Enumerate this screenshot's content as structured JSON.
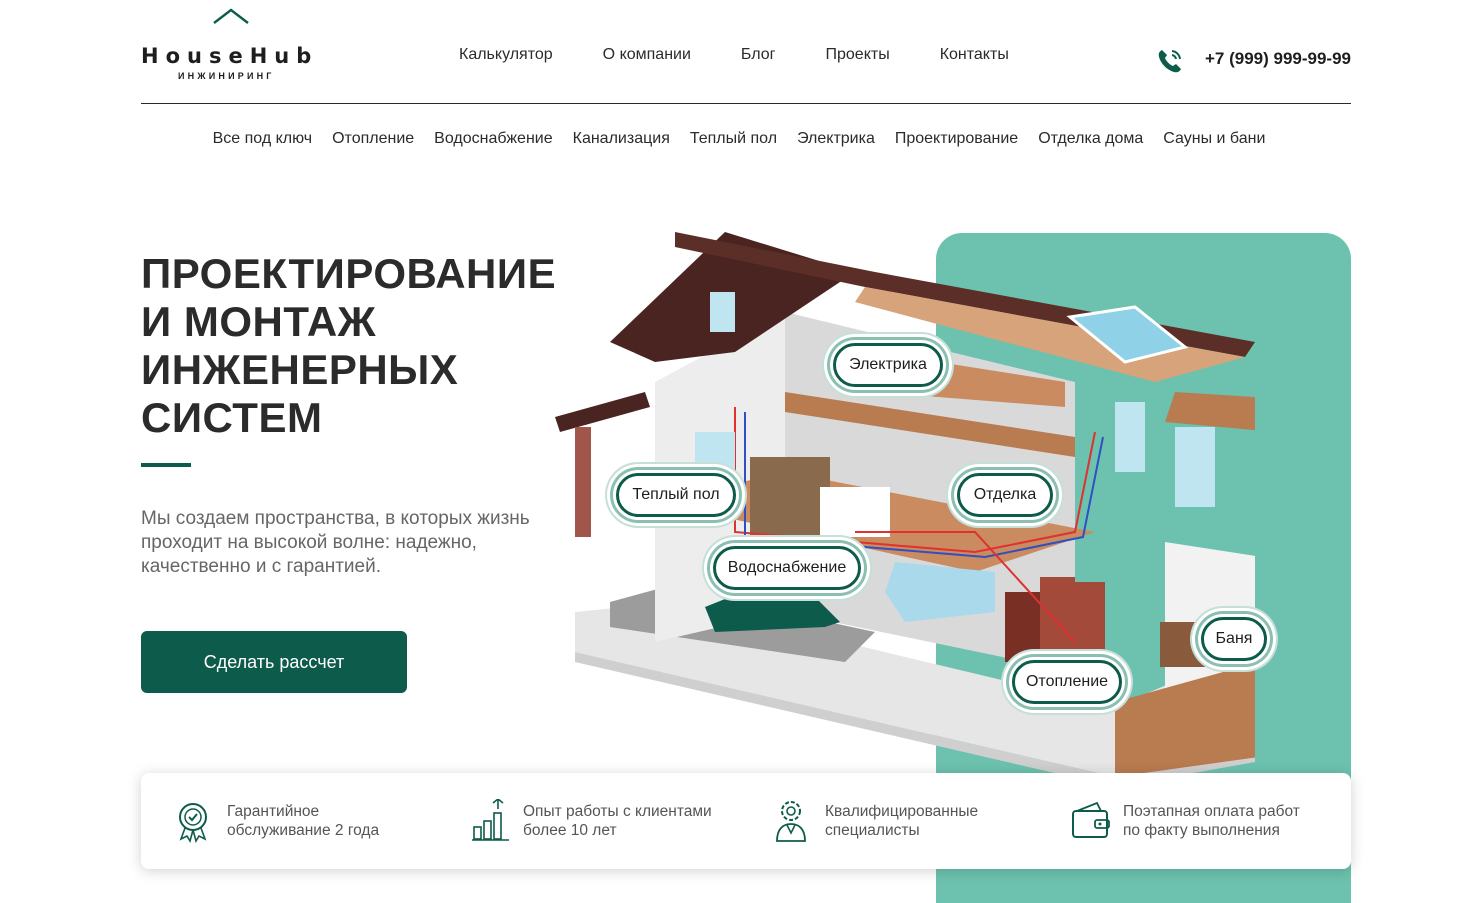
{
  "brand": {
    "name": "HouseHub",
    "subtitle": "ИНЖИНИРИНГ"
  },
  "topnav": [
    "Калькулятор",
    "О компании",
    "Блог",
    "Проекты",
    "Контакты"
  ],
  "phone": "+7 (999) 999-99-99",
  "subnav": [
    "Все под ключ",
    "Отопление",
    "Водоснабжение",
    "Канализация",
    "Теплый пол",
    "Электрика",
    "Проектирование",
    "Отделка дома",
    "Сауны и бани"
  ],
  "hero": {
    "title_lines": [
      "ПРОЕКТИРОВАНИЕ",
      "И МОНТАЖ",
      "ИНЖЕНЕРНЫХ",
      "СИСТЕМ"
    ],
    "description": "Мы создаем пространства, в которых жизнь проходит на высокой волне: надежно, качественно и с гарантией.",
    "cta": "Сделать рассчет"
  },
  "house_labels": {
    "electric": "Электрика",
    "floor": "Теплый пол",
    "finishing": "Отделка",
    "water": "Водоснабжение",
    "sauna": "Баня",
    "heating": "Отопление"
  },
  "features": [
    {
      "icon": "warranty-badge-icon",
      "text": "Гарантийное\nобслуживание 2 года"
    },
    {
      "icon": "growth-chart-icon",
      "text": "Опыт работы с клиентами\nболее 10 лет"
    },
    {
      "icon": "specialist-gear-icon",
      "text": "Квалифицированные\nспециалисты"
    },
    {
      "icon": "wallet-icon",
      "text": "Поэтапная оплата работ\nпо факту выполнения"
    }
  ],
  "colors": {
    "brand_green": "#0d5c4b",
    "accent_mint": "#6cc2ae",
    "roof_brown": "#4a2420"
  }
}
